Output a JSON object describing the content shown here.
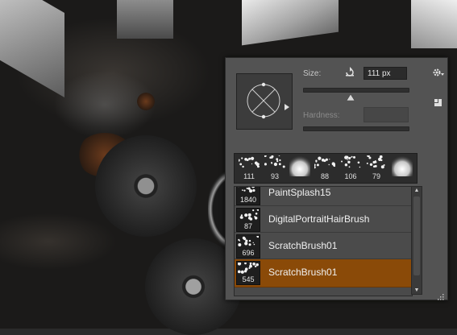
{
  "brush_panel": {
    "size_label": "Size:",
    "size_value": "111 px",
    "size_level_fraction": 0.45,
    "hardness_label": "Hardness:",
    "presets": [
      {
        "value": "111",
        "kind": "splash"
      },
      {
        "value": "93",
        "kind": "splash"
      },
      {
        "value": "",
        "kind": "soft-round"
      },
      {
        "value": "88",
        "kind": "splash"
      },
      {
        "value": "106",
        "kind": "splash"
      },
      {
        "value": "79",
        "kind": "splash"
      },
      {
        "value": "",
        "kind": "soft-round"
      }
    ],
    "brushes": [
      {
        "size": "1840",
        "name": "PaintSplash15",
        "selected": false
      },
      {
        "size": "87",
        "name": "DigitalPortraitHairBrush",
        "selected": false
      },
      {
        "size": "696",
        "name": "ScratchBrush01",
        "selected": false
      },
      {
        "size": "545",
        "name": "ScratchBrush01",
        "selected": true
      }
    ],
    "colors": {
      "panel_bg": "#535353",
      "selection": "#8a4a08"
    }
  }
}
